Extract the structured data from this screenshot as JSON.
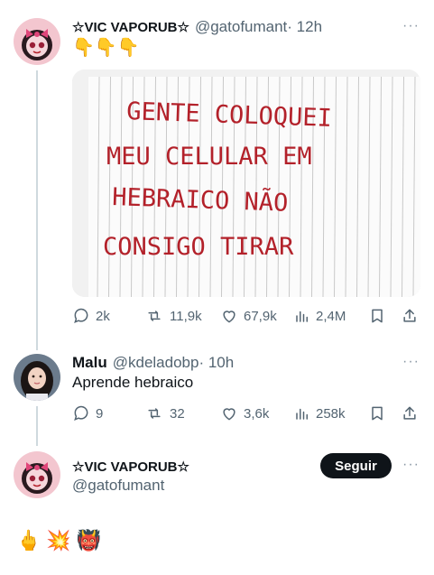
{
  "tweet1": {
    "display_name": "☆VIC VAPORUB☆",
    "handle": "@gatofumant",
    "time": "· 12h",
    "text": "👇👇👇",
    "image_caption_lines": [
      "GENTE COLOQUEI",
      "MEU CELULAR EM",
      "HEBRAICO NÃO",
      "CONSIGO TIRAR"
    ],
    "stats": {
      "replies": "2k",
      "reposts": "11,9k",
      "likes": "67,9k",
      "views": "2,4M"
    },
    "more": "···"
  },
  "reply": {
    "display_name": "Malu",
    "handle": "@kdeladobp",
    "time": "· 10h",
    "text": "Aprende hebraico",
    "stats": {
      "replies": "9",
      "reposts": "32",
      "likes": "3,6k",
      "views": "258k"
    },
    "more": "···"
  },
  "tweet3": {
    "display_name": "☆VIC VAPORUB☆",
    "handle": "@gatofumant",
    "follow_label": "Seguir",
    "more": "···",
    "text_emojis": [
      "🖕",
      "💥",
      "👹"
    ]
  },
  "colors": {
    "text": "#0f1419",
    "secondary": "#536471",
    "thread_line": "#cfd9de",
    "marker_red": "#b3212a",
    "follow_bg": "#0f1419"
  },
  "icons": {
    "reply": "reply-bubble-icon",
    "repost": "repost-icon",
    "like": "heart-icon",
    "views": "views-bar-icon",
    "bookmark": "bookmark-icon",
    "share": "share-icon"
  }
}
